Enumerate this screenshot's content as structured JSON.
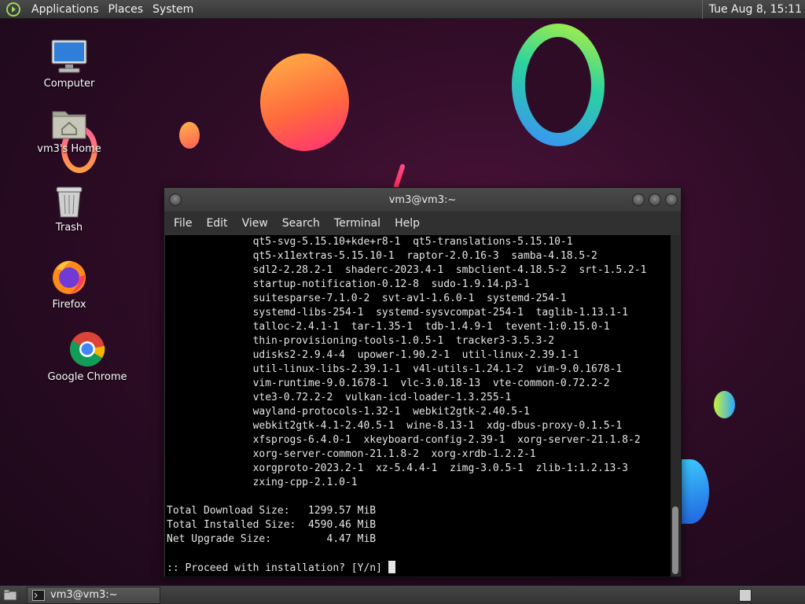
{
  "top_panel": {
    "menus": [
      "Applications",
      "Places",
      "System"
    ],
    "clock": "Tue Aug  8, 15:11"
  },
  "desktop_icons": [
    {
      "label": "Computer",
      "icon": "computer-icon"
    },
    {
      "label": "vm3's Home",
      "icon": "home-folder-icon"
    },
    {
      "label": "Trash",
      "icon": "trash-icon"
    },
    {
      "label": "Firefox",
      "icon": "firefox-icon"
    },
    {
      "label": "Google Chrome",
      "icon": "chrome-icon"
    }
  ],
  "terminal": {
    "title": "vm3@vm3:~",
    "menu": [
      "File",
      "Edit",
      "View",
      "Search",
      "Terminal",
      "Help"
    ],
    "lines": [
      "              qt5-svg-5.15.10+kde+r8-1  qt5-translations-5.15.10-1",
      "              qt5-x11extras-5.15.10-1  raptor-2.0.16-3  samba-4.18.5-2",
      "              sdl2-2.28.2-1  shaderc-2023.4-1  smbclient-4.18.5-2  srt-1.5.2-1",
      "              startup-notification-0.12-8  sudo-1.9.14.p3-1",
      "              suitesparse-7.1.0-2  svt-av1-1.6.0-1  systemd-254-1",
      "              systemd-libs-254-1  systemd-sysvcompat-254-1  taglib-1.13.1-1",
      "              talloc-2.4.1-1  tar-1.35-1  tdb-1.4.9-1  tevent-1:0.15.0-1",
      "              thin-provisioning-tools-1.0.5-1  tracker3-3.5.3-2",
      "              udisks2-2.9.4-4  upower-1.90.2-1  util-linux-2.39.1-1",
      "              util-linux-libs-2.39.1-1  v4l-utils-1.24.1-2  vim-9.0.1678-1",
      "              vim-runtime-9.0.1678-1  vlc-3.0.18-13  vte-common-0.72.2-2",
      "              vte3-0.72.2-2  vulkan-icd-loader-1.3.255-1",
      "              wayland-protocols-1.32-1  webkit2gtk-2.40.5-1",
      "              webkit2gtk-4.1-2.40.5-1  wine-8.13-1  xdg-dbus-proxy-0.1.5-1",
      "              xfsprogs-6.4.0-1  xkeyboard-config-2.39-1  xorg-server-21.1.8-2",
      "              xorg-server-common-21.1.8-2  xorg-xrdb-1.2.2-1",
      "              xorgproto-2023.2-1  xz-5.4.4-1  zimg-3.0.5-1  zlib-1:1.2.13-3",
      "              zxing-cpp-2.1.0-1",
      "",
      "Total Download Size:   1299.57 MiB",
      "Total Installed Size:  4590.46 MiB",
      "Net Upgrade Size:         4.47 MiB",
      "",
      ":: Proceed with installation? [Y/n] "
    ]
  },
  "taskbar": {
    "task_label": "vm3@vm3:~"
  }
}
